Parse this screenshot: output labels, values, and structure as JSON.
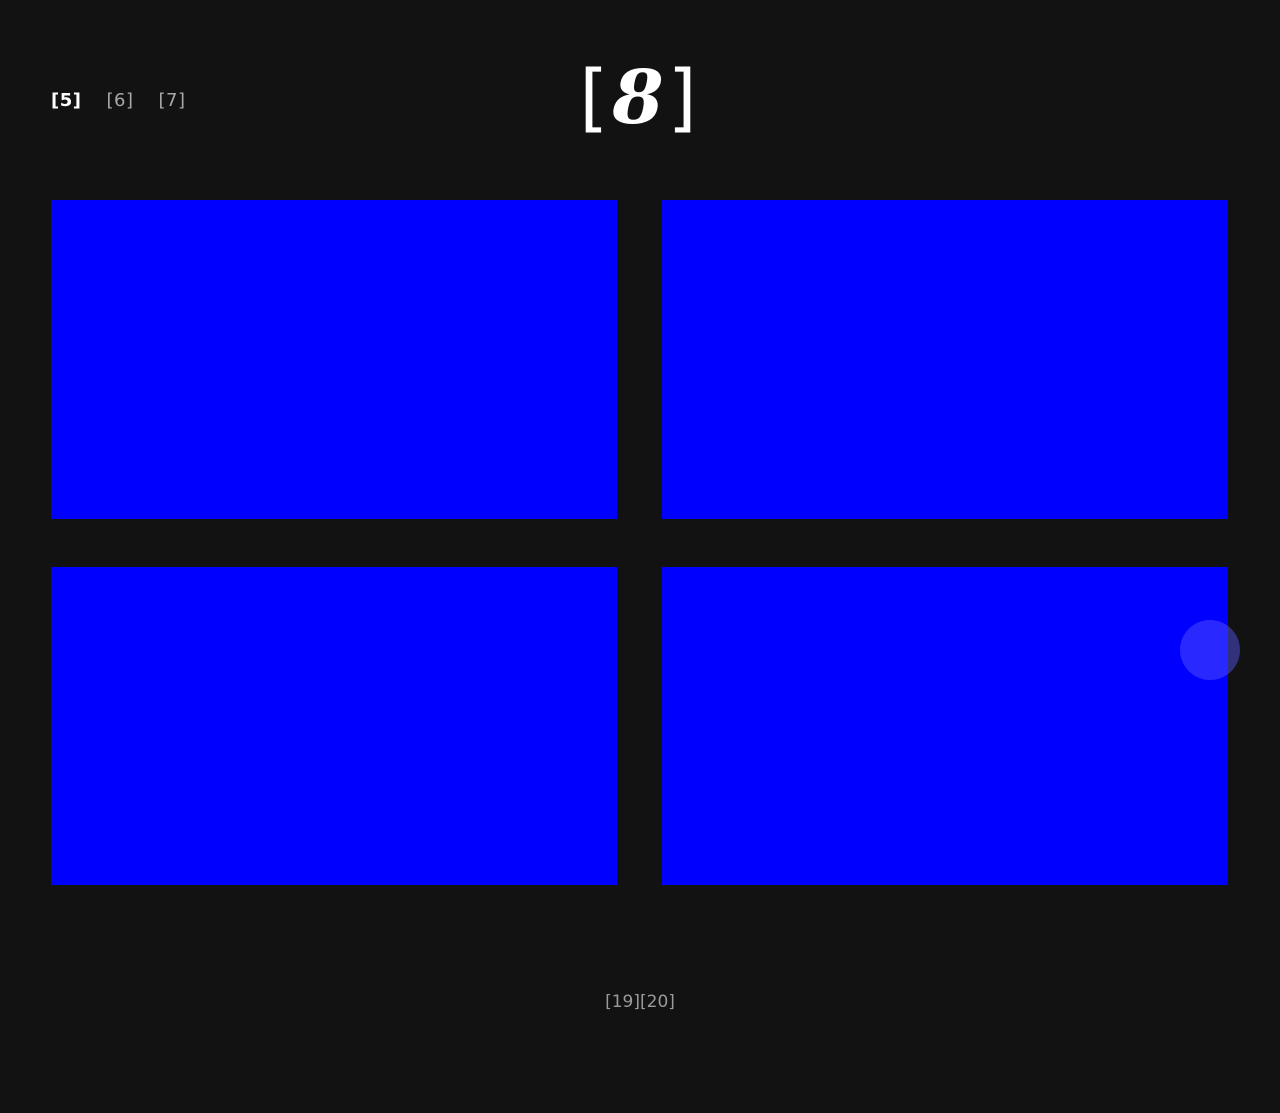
{
  "nav": {
    "items": [
      {
        "label": "[5]",
        "active": true
      },
      {
        "label": "[6]",
        "active": false
      },
      {
        "label": "[7]",
        "active": false
      }
    ]
  },
  "logo": {
    "open": "[",
    "digit": "8",
    "close": "]"
  },
  "tiles": {
    "color": "#0000ff"
  },
  "pager": {
    "pages": [
      "[19]",
      "[20]"
    ]
  },
  "colors": {
    "background": "#121212",
    "text_active": "#ffffff",
    "text_muted": "#a8a8a8"
  }
}
